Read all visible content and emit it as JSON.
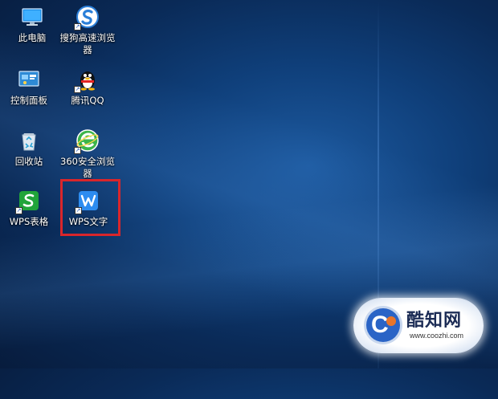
{
  "desktop": {
    "icons": [
      {
        "label": "此电脑",
        "icon": "computer-icon"
      },
      {
        "label": "搜狗高速浏览器",
        "icon": "sogou-browser-icon"
      },
      {
        "label": "控制面板",
        "icon": "control-panel-icon"
      },
      {
        "label": "腾讯QQ",
        "icon": "qq-penguin-icon"
      },
      {
        "label": "回收站",
        "icon": "recycle-bin-icon"
      },
      {
        "label": "360安全浏览器",
        "icon": "360-browser-icon"
      },
      {
        "label": "WPS表格",
        "icon": "wps-spreadsheet-icon"
      },
      {
        "label": "WPS文字",
        "icon": "wps-writer-icon"
      }
    ],
    "highlighted_icon": "WPS文字",
    "highlight_color": "#d9262b"
  },
  "watermark": {
    "title": "酷知网",
    "url": "www.coozhi.com",
    "logo_letter": "C",
    "logo_color": "#2a64c6"
  },
  "colors": {
    "wallpaper_base": "#0f3f7a",
    "wps_spreadsheet_green": "#21a43a",
    "wps_writer_blue": "#2d8cf0"
  }
}
